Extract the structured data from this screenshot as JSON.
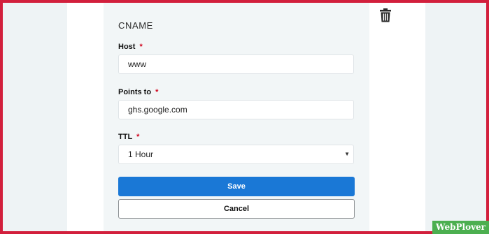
{
  "record": {
    "type_label": "CNAME",
    "host": {
      "label": "Host",
      "required_mark": "*",
      "value": "www"
    },
    "points_to": {
      "label": "Points to",
      "required_mark": "*",
      "value": "ghs.google.com"
    },
    "ttl": {
      "label": "TTL",
      "required_mark": "*",
      "selected": "1 Hour",
      "arrow": "▼"
    }
  },
  "actions": {
    "save_label": "Save",
    "cancel_label": "Cancel"
  },
  "icons": {
    "delete": "trash-icon"
  },
  "watermark": {
    "text": "WebPlover"
  },
  "colors": {
    "primary": "#1a78d6",
    "required": "#d0021b",
    "frame": "#d21f3c",
    "watermark_bg": "#4caf50"
  }
}
